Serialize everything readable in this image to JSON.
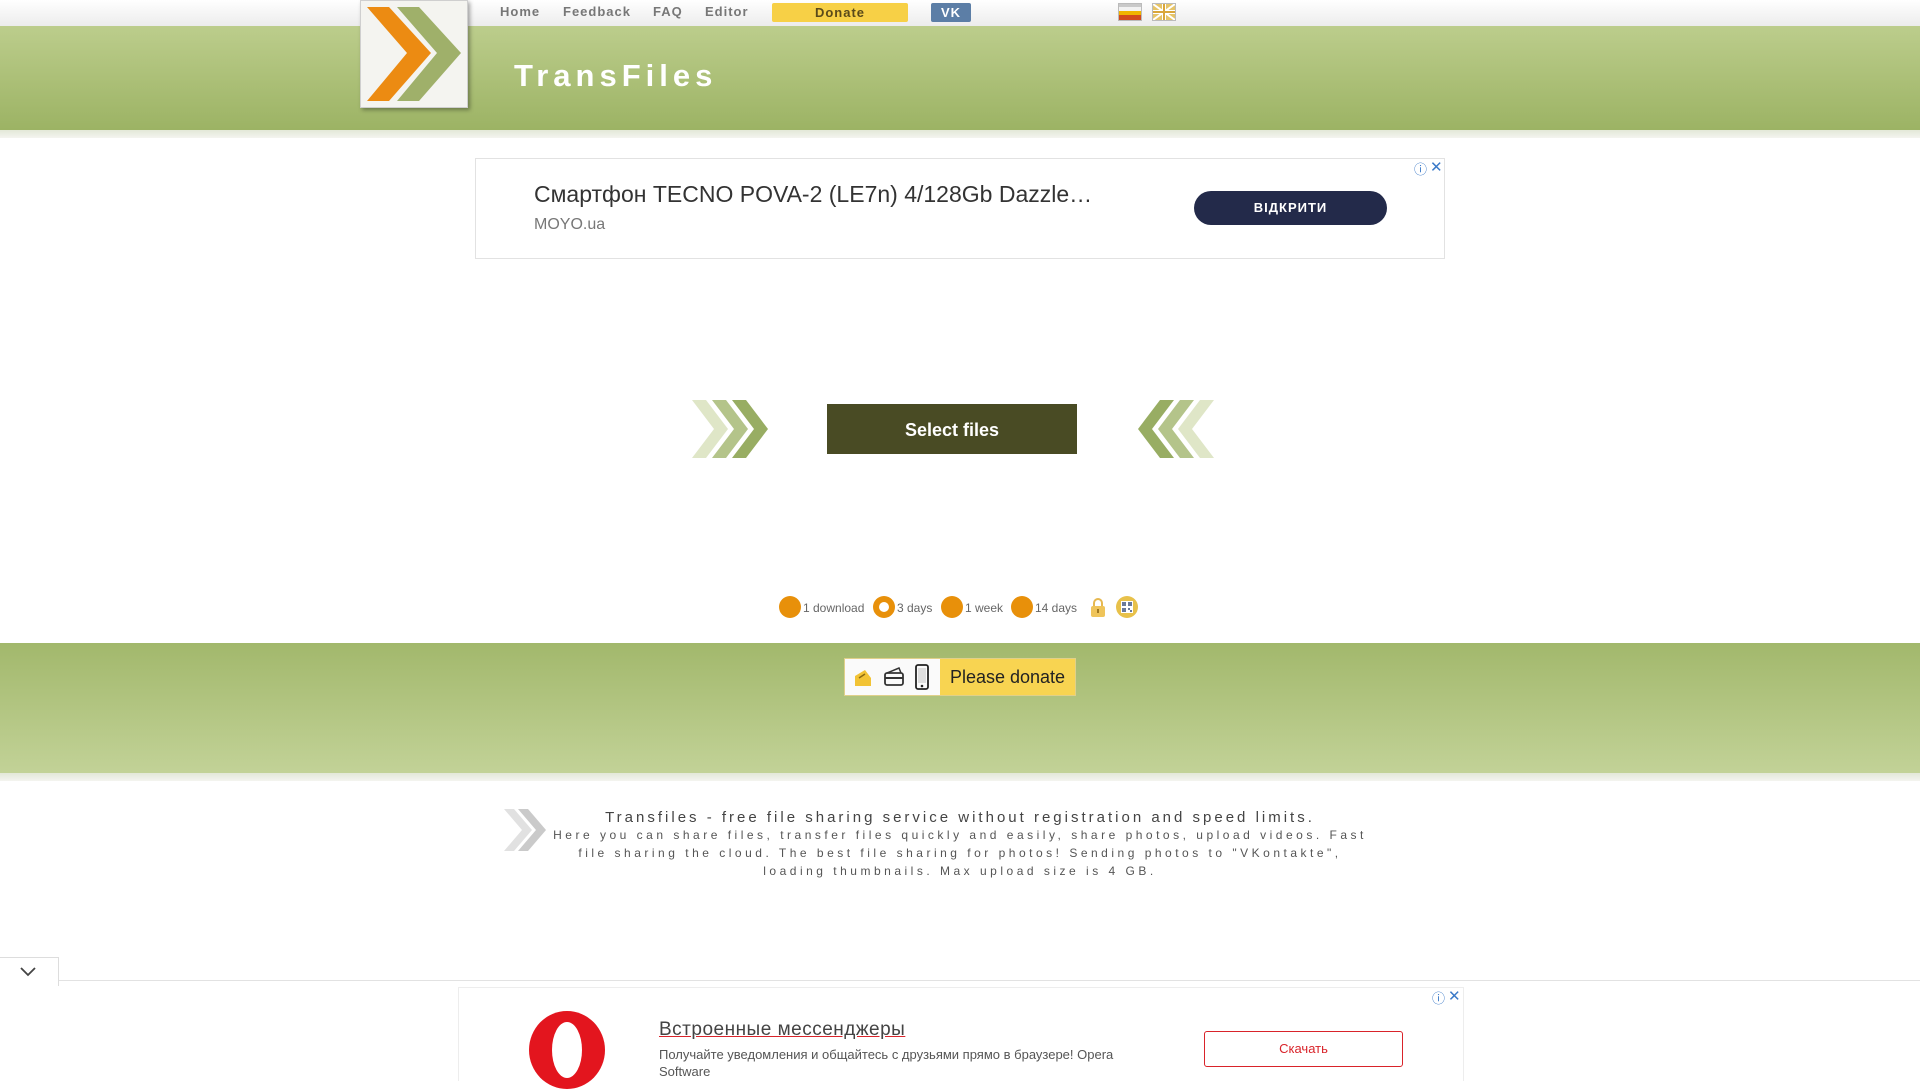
{
  "nav": {
    "home": "Home",
    "feedback": "Feedback",
    "faq": "FAQ",
    "editor": "Editor",
    "donate": "Donate",
    "vk": "VK"
  },
  "brand": {
    "name": "TransFiles"
  },
  "ad_top": {
    "title": "Смартфон TECNO POVA-2 (LE7n) 4/128Gb Dazzle…",
    "source": "MOYO.ua",
    "button": "ВІДКРИТИ"
  },
  "upload": {
    "select_label": "Select files",
    "options": [
      {
        "label": "1 download",
        "selected": false
      },
      {
        "label": "3 days",
        "selected": true
      },
      {
        "label": "1 week",
        "selected": false
      },
      {
        "label": "14 days",
        "selected": false
      }
    ]
  },
  "donate_band": {
    "label": "Please donate"
  },
  "description": {
    "title": "Transfiles - free file sharing service without registration and speed limits.",
    "body": "Here you can share files, transfer files quickly and easily, share photos, upload videos. Fast file sharing the cloud. The best file sharing for photos! Sending photos to \"VKontakte\", loading thumbnails. Max upload size is 4 GB."
  },
  "ad_bottom": {
    "title": "Встроенные мессенджеры",
    "text": "Получайте уведомления и общайтесь с друзьями прямо в браузере! Opera Software",
    "button": "Скачать"
  },
  "colors": {
    "header_green": "#aebf7a",
    "select_button": "#494b24",
    "accent_orange": "#e8900a",
    "donate_yellow": "#f8d451",
    "vk_blue": "#5c7ea6"
  },
  "icons": [
    "logo-chevron-icon",
    "ua-flag-icon",
    "en-flag-icon",
    "chevrons-right-icon",
    "chevrons-left-icon",
    "lock-icon",
    "qr-code-icon",
    "card-icon",
    "wallet-icon",
    "phone-icon",
    "ad-info-icon",
    "ad-close-icon",
    "collapse-chevron-icon",
    "opera-logo-icon"
  ]
}
